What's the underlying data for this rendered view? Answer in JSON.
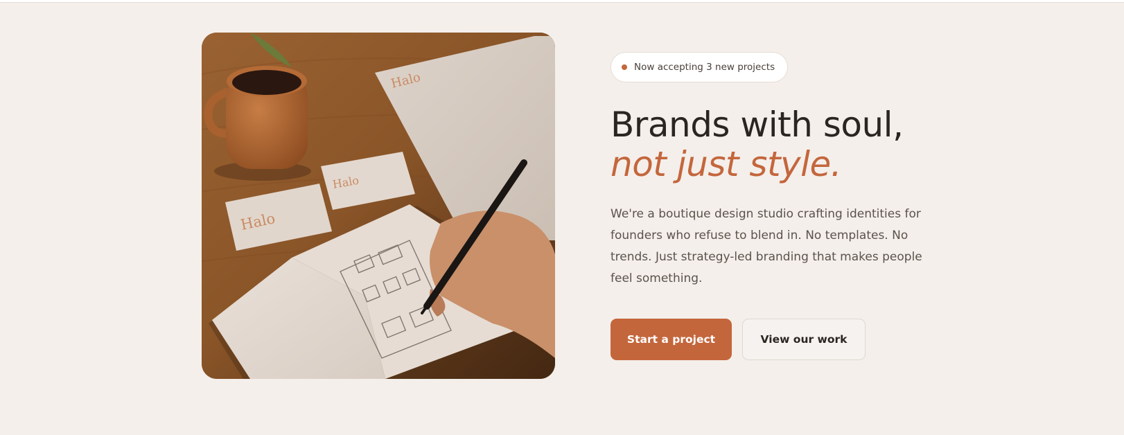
{
  "hero": {
    "image": {
      "alt": "Notebook with sketches, Halo business cards and coffee mug on wooden desk",
      "brand_marks": [
        "Halo",
        "Halo",
        "Halo"
      ]
    },
    "badge": "Now accepting 3 new projects",
    "title_line1": "Brands with soul,",
    "title_line2": "not just style.",
    "description": "We're a boutique design studio crafting identities for founders who refuse to blend in. No templates. No trends. Just strategy-led branding that makes people feel something.",
    "primary_cta": "Start a project",
    "secondary_cta": "View our work"
  },
  "colors": {
    "accent": "#c4663c",
    "background": "#f4efeb",
    "text": "#2a2521",
    "muted_text": "#5b524b"
  },
  "icons": {
    "badge_dot": "status-dot-icon"
  }
}
